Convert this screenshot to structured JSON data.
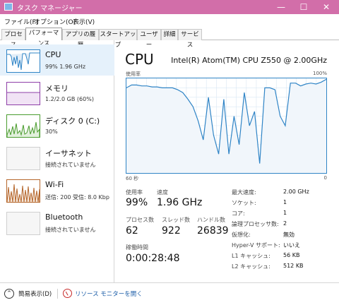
{
  "window": {
    "title": "タスク マネージャー",
    "min": "—",
    "max": "☐",
    "close": "✕"
  },
  "menu": [
    "ファイル(F)",
    "オプション(O)",
    "表示(V)"
  ],
  "tabs": [
    "プロセス",
    "パフォーマンス",
    "アプリの履歴",
    "スタートアップ",
    "ユーザー",
    "詳細",
    "サービス"
  ],
  "active_tab": "パフォーマンス",
  "sidebar": [
    {
      "name": "CPU",
      "sub": "99%  1.96 GHz",
      "color": "#2f84c6"
    },
    {
      "name": "メモリ",
      "sub": "1.2/2.0 GB (60%)",
      "color": "#8e3fa8"
    },
    {
      "name": "ディスク 0 (C:)",
      "sub": "30%",
      "color": "#4a9c2e"
    },
    {
      "name": "イーサネット",
      "sub": "接続されていません",
      "color": "#cfcfcf"
    },
    {
      "name": "Wi-Fi",
      "sub": "送信: 200  受信: 8.0 Kbp",
      "color": "#b5662b"
    },
    {
      "name": "Bluetooth",
      "sub": "接続されていません",
      "color": "#cfcfcf"
    }
  ],
  "main": {
    "title": "CPU",
    "model": "Intel(R) Atom(TM) CPU Z550 @ 2.00GHz",
    "graph": {
      "ylabel": "使用率",
      "ymax": "100%",
      "xlabel_left": "60 秒",
      "xlabel_right": "0"
    },
    "usage_label": "使用率",
    "usage": "99%",
    "speed_label": "速度",
    "speed": "1.96 GHz",
    "processes_label": "プロセス数",
    "processes": "62",
    "threads_label": "スレッド数",
    "threads": "922",
    "handles_label": "ハンドル数",
    "handles": "26839",
    "uptime_label": "稼働時間",
    "uptime": "0:00:28:48",
    "specs": [
      {
        "key": "最大速度:",
        "value": "2.00 GHz"
      },
      {
        "key": "ソケット:",
        "value": "1"
      },
      {
        "key": "コア:",
        "value": "1"
      },
      {
        "key": "論理プロセッサ数:",
        "value": "2"
      },
      {
        "key": "仮想化:",
        "value": "無効"
      },
      {
        "key": "Hyper-V サポート:",
        "value": "いいえ"
      },
      {
        "key": "L1 キャッシュ:",
        "value": "56 KB"
      },
      {
        "key": "L2 キャッシュ:",
        "value": "512 KB"
      }
    ]
  },
  "footer": {
    "fewer_details": "簡易表示(D)",
    "resource_monitor": "リソース モニターを開く"
  },
  "cpu_history": {
    "unit": "%",
    "values": [
      90,
      93,
      93,
      92,
      92,
      91,
      91,
      90,
      90,
      90,
      88,
      85,
      78,
      70,
      55,
      35,
      80,
      40,
      20,
      78,
      20,
      60,
      30,
      85,
      50,
      65,
      10,
      90,
      90,
      88,
      60,
      50,
      95,
      95,
      92,
      94,
      95,
      94,
      96,
      99
    ]
  },
  "colors": {
    "accent": "#2f84c6",
    "graph_fill": "#f1f6fb",
    "grid": "#d9e7f3"
  }
}
